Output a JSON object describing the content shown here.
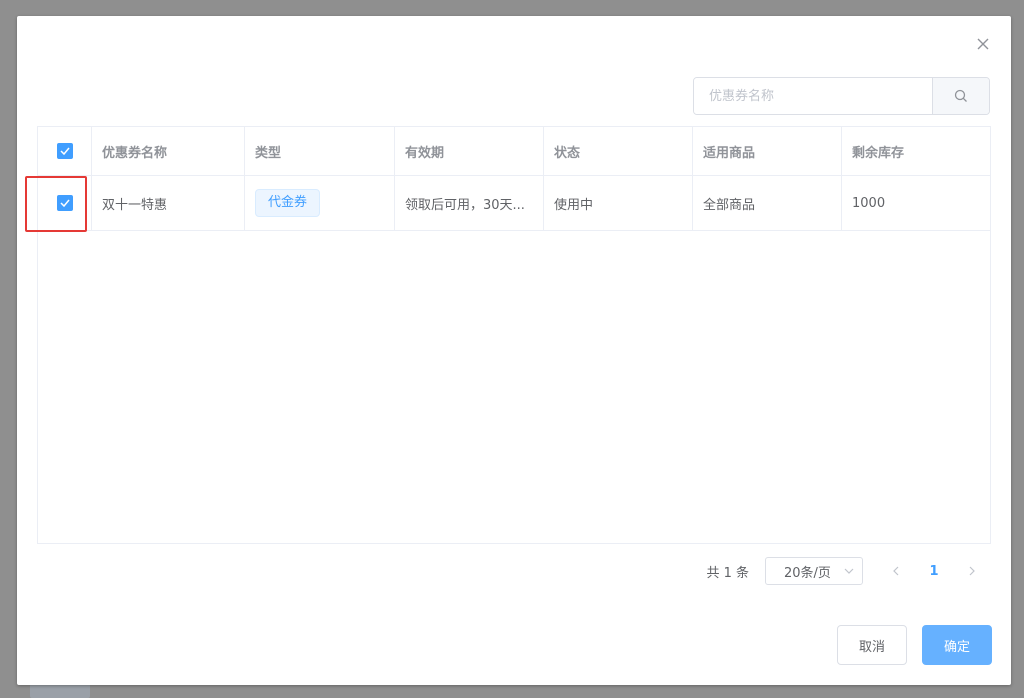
{
  "search": {
    "placeholder": "优惠券名称"
  },
  "table": {
    "columns": [
      "优惠券名称",
      "类型",
      "有效期",
      "状态",
      "适用商品",
      "剩余库存"
    ],
    "rows": [
      {
        "name": "双十一特惠",
        "type": "代金券",
        "validity": "领取后可用，30天...",
        "status": "使用中",
        "goods": "全部商品",
        "stock": "1000"
      }
    ]
  },
  "pagination": {
    "total": "共 1 条",
    "page_size": "20条/页",
    "current": "1"
  },
  "footer": {
    "cancel": "取消",
    "confirm": "确定"
  },
  "colors": {
    "accent": "#409eff",
    "highlight": "#e53935"
  }
}
